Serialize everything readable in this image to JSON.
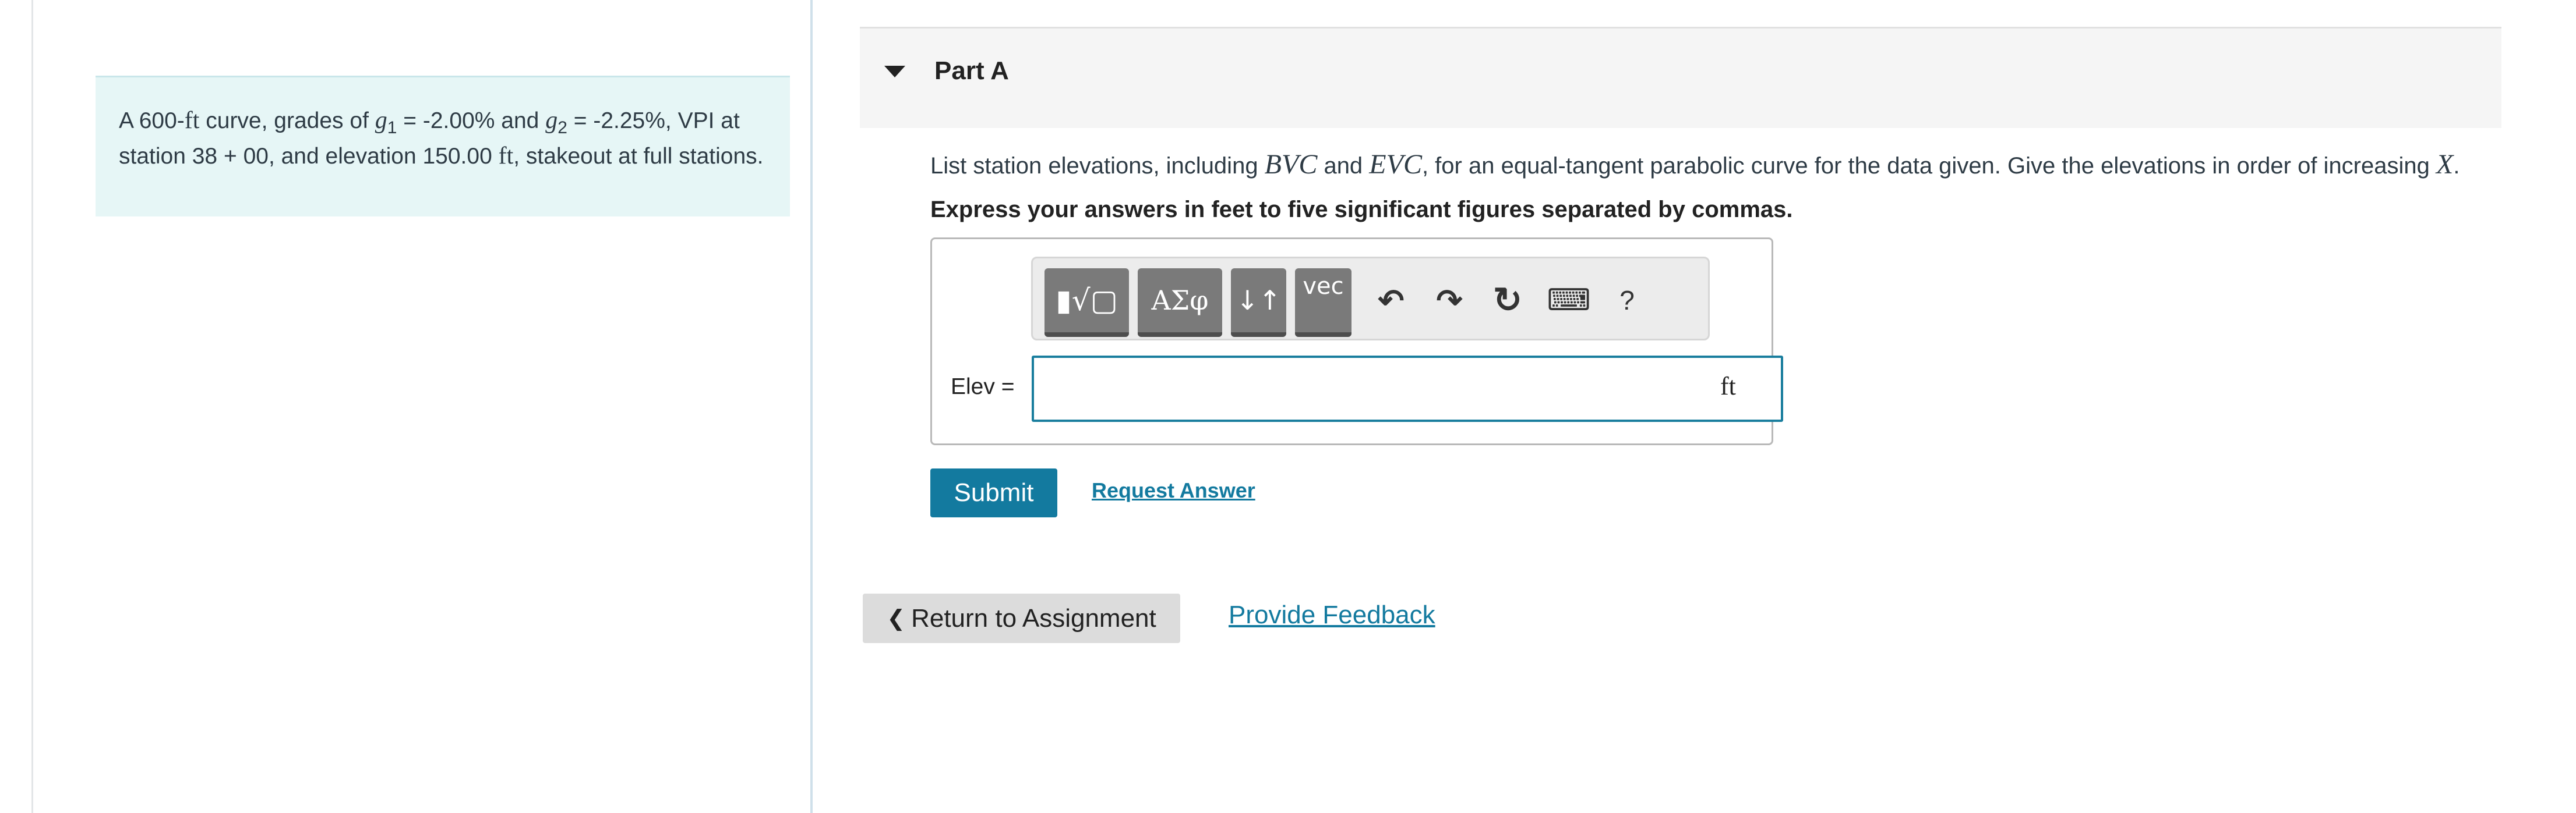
{
  "problem": {
    "t1": "A 600-",
    "ft1": "ft",
    "t2": " curve, grades of ",
    "g1_var": "g",
    "g1_sub": "1",
    "t3": " = -2.00% and ",
    "g2_var": "g",
    "g2_sub": "2",
    "t4": " = -2.25%, VPI at station 38 + 00, and elevation 150.00 ",
    "ft2": "ft",
    "t5": ", stakeout at full stations."
  },
  "part": {
    "title": "Part A"
  },
  "question": {
    "p1": "List station elevations, including ",
    "bvc": "BVC",
    "p2": " and ",
    "evc": "EVC",
    "p3": ", for an equal-tangent parabolic curve for the data given. Give the elevations in order of increasing ",
    "x": "X",
    "p4": ".",
    "instruction": "Express your answers in feet to five significant figures separated by commas."
  },
  "toolbar": {
    "templates_glyph": "▮√▢",
    "symbols_label": "ΑΣφ",
    "arrows_glyph": "↓↑",
    "vec_label": "vec",
    "undo_glyph": "↶",
    "redo_glyph": "↷",
    "reset_glyph": "↻",
    "keyboard_glyph": "⌨",
    "help_label": "?",
    "icons": [
      "templates-icon",
      "greek-symbols-icon",
      "arrows-icon",
      "vector-icon",
      "undo-icon",
      "redo-icon",
      "reset-icon",
      "keyboard-icon",
      "help-icon"
    ]
  },
  "answer": {
    "label": "Elev =",
    "value": "",
    "unit": "ft"
  },
  "actions": {
    "submit": "Submit",
    "request": "Request Answer"
  },
  "footer": {
    "return_chevron": "❮",
    "return_label": "Return to Assignment",
    "feedback": "Provide Feedback"
  },
  "colors": {
    "accent": "#137a9f",
    "problem_bg": "#e6f6f6",
    "header_bg": "#f5f5f5",
    "input_border": "#1a7e9e"
  }
}
